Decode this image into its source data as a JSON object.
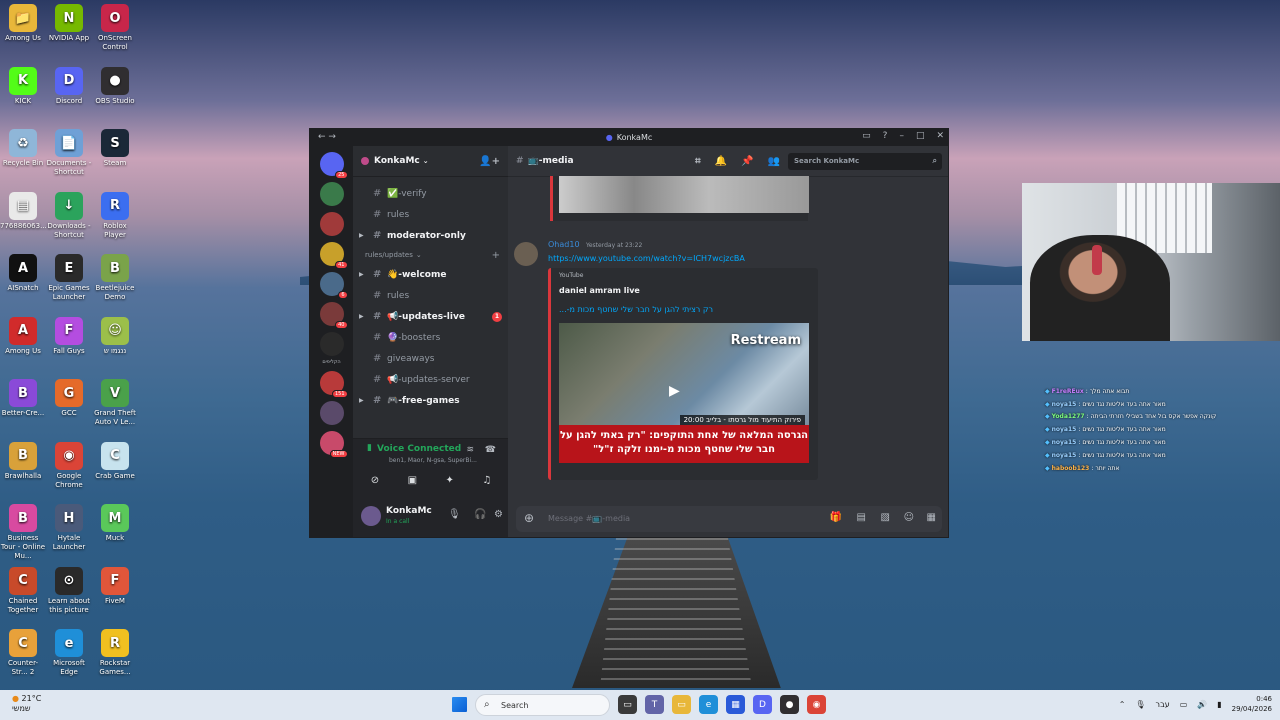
{
  "desktop": {
    "icons": [
      {
        "label": "Among Us",
        "glyph": "📁",
        "color": "#e8b73a"
      },
      {
        "label": "NVIDIA App",
        "glyph": "N",
        "color": "#76b900"
      },
      {
        "label": "OnScreen Control",
        "glyph": "O",
        "color": "#c8264a"
      },
      {
        "label": "KICK",
        "glyph": "K",
        "color": "#53fc18"
      },
      {
        "label": "Discord",
        "glyph": "D",
        "color": "#5865f2"
      },
      {
        "label": "OBS Studio",
        "glyph": "●",
        "color": "#302e31"
      },
      {
        "label": "Recycle Bin",
        "glyph": "♻",
        "color": "#8fb6d8"
      },
      {
        "label": "Documents - Shortcut",
        "glyph": "📄",
        "color": "#6fa0d6"
      },
      {
        "label": "Steam",
        "glyph": "S",
        "color": "#1b2838"
      },
      {
        "label": "776886063...",
        "glyph": "▤",
        "color": "#e9e9e9"
      },
      {
        "label": "Downloads - Shortcut",
        "glyph": "↓",
        "color": "#2ba35c"
      },
      {
        "label": "Roblox Player",
        "glyph": "R",
        "color": "#3b6ef0"
      },
      {
        "label": "AISnatch",
        "glyph": "A",
        "color": "#111111"
      },
      {
        "label": "Epic Games Launcher",
        "glyph": "E",
        "color": "#2a2a2a"
      },
      {
        "label": "Beetlejuice Demo",
        "glyph": "B",
        "color": "#7aa34a"
      },
      {
        "label": "Among Us",
        "glyph": "A",
        "color": "#d12b2b"
      },
      {
        "label": "Fall Guys",
        "glyph": "F",
        "color": "#b44de0"
      },
      {
        "label": "ננגמו ש",
        "glyph": "☺",
        "color": "#9bbf4a"
      },
      {
        "label": "Better-Cre...",
        "glyph": "B",
        "color": "#8a4ad8"
      },
      {
        "label": "GCC",
        "glyph": "G",
        "color": "#e56a2a"
      },
      {
        "label": "Grand Theft Auto V Le...",
        "glyph": "V",
        "color": "#4aa14a"
      },
      {
        "label": "Brawlhalla",
        "glyph": "B",
        "color": "#d8a13a"
      },
      {
        "label": "Google Chrome",
        "glyph": "◉",
        "color": "#db4437"
      },
      {
        "label": "Crab Game",
        "glyph": "C",
        "color": "#c7e3ee"
      },
      {
        "label": "Business Tour - Online Mu...",
        "glyph": "B",
        "color": "#d84aa0"
      },
      {
        "label": "Hytale Launcher",
        "glyph": "H",
        "color": "#4a5a7a"
      },
      {
        "label": "Muck",
        "glyph": "M",
        "color": "#5ac85a"
      },
      {
        "label": "Chained Together",
        "glyph": "C",
        "color": "#c84a2a"
      },
      {
        "label": "Learn about this picture",
        "glyph": "⊙",
        "color": "#2a2a2a"
      },
      {
        "label": "FiveM",
        "glyph": "F",
        "color": "#e0563a"
      },
      {
        "label": "Counter-Str... 2",
        "glyph": "C",
        "color": "#e8a13a"
      },
      {
        "label": "Microsoft Edge",
        "glyph": "e",
        "color": "#1f8fd8"
      },
      {
        "label": "Rockstar Games...",
        "glyph": "R",
        "color": "#f0c020"
      }
    ]
  },
  "discord": {
    "window_title": "KonkaMc",
    "server_name": "KonkaMc",
    "guild_badges": [
      "25",
      "",
      "",
      "41",
      "6",
      "40",
      "",
      "151",
      "",
      "NEW"
    ],
    "guild_colors": [
      "#5865f2",
      "#3a7a4a",
      "#a03a3a",
      "#c8a02a",
      "#4a6a8a",
      "#7a3a3a",
      "#2a2a2a",
      "#b83a3a",
      "#5a4a6a",
      "#c84a6a"
    ],
    "guild_label": "הקליפים",
    "channels_top": [
      {
        "name": "✅-verify",
        "bold": false,
        "arrow": false
      },
      {
        "name": "rules",
        "bold": false,
        "arrow": false
      },
      {
        "name": "moderator-only",
        "bold": true,
        "arrow": true
      }
    ],
    "category": "rules/updates",
    "channels": [
      {
        "name": "👋-welcome",
        "bold": true,
        "arrow": true,
        "unread": ""
      },
      {
        "name": "rules",
        "bold": false,
        "arrow": false,
        "unread": ""
      },
      {
        "name": "📢-updates-live",
        "bold": true,
        "arrow": true,
        "unread": "1"
      },
      {
        "name": "🔮-boosters",
        "bold": false,
        "arrow": false,
        "unread": ""
      },
      {
        "name": "giveaways",
        "bold": false,
        "arrow": false,
        "unread": ""
      },
      {
        "name": "📢-updates-server",
        "bold": false,
        "arrow": false,
        "unread": ""
      },
      {
        "name": "🎮-free-games",
        "bold": true,
        "arrow": true,
        "unread": ""
      }
    ],
    "voice": {
      "status": "Voice Connected",
      "names": "ben1, Maor, N-gsa, SuperBi..."
    },
    "user": {
      "name": "KonkaMc",
      "status": "In a call"
    },
    "channel_header": "📺-media",
    "search_placeholder": "Search KonkaMc",
    "message": {
      "author": "Ohad10",
      "time": "Yesterday at 23:22",
      "link": "https://www.youtube.com/watch?v=ICH7wcjzcBA",
      "embed_provider": "YouTube",
      "embed_author": "daniel amram live",
      "embed_title": "רק רציתי להגן על חבר שלי שחטף מכות מ-...",
      "video_brand": "Restream",
      "video_caption_top": "פירוק התיעוד מול גרסתו - בלייב 20:00",
      "video_caption": "הגרסה המלאה של אחת התוקפים: \"רק באתי להגן על חבר שלי שחטף מכות מ-ימנו זלקה ז\"ל\""
    },
    "composer_placeholder": "Message #📺-media"
  },
  "stream_chat": [
    {
      "name": "F1reREux",
      "text": "תבוא אתה מלך",
      "color": "#c77dff"
    },
    {
      "name": "noya15",
      "text": "מאור אתה בעד אליטות נגד נשים",
      "color": "#9ad0ff"
    },
    {
      "name": "Yoda1277",
      "text": "קונקה אפשר אקס בול אחד בשבילי חזרתי הביתה",
      "color": "#7cfc7c"
    },
    {
      "name": "noya15",
      "text": "מאור אתה בעד אליטות נגד נשים",
      "color": "#9ad0ff"
    },
    {
      "name": "noya15",
      "text": "מאור אתה בעד אליטות נגד נשים",
      "color": "#9ad0ff"
    },
    {
      "name": "noya15",
      "text": "מאור אתה בעד אליטות נגד נשים",
      "color": "#9ad0ff"
    },
    {
      "name": "haboob123",
      "text": "אתה יותר",
      "color": "#ffb347"
    }
  ],
  "taskbar": {
    "weather_temp": "21°C",
    "weather_desc": "שמשי",
    "search_label": "Search",
    "language": "עבר",
    "time": "0:46",
    "date": "29/04/2026"
  }
}
